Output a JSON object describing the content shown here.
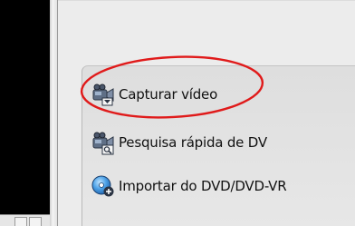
{
  "menu": {
    "items": [
      {
        "label": "Capturar vídeo",
        "icon": "video-camera-capture-icon"
      },
      {
        "label": "Pesquisa rápida de DV",
        "icon": "camcorder-search-icon"
      },
      {
        "label": "Importar do DVD/DVD-VR",
        "icon": "dvd-import-icon"
      }
    ]
  },
  "colors": {
    "annotation": "#e01a1a",
    "panel": "#e2e2e2",
    "player_background": "#000000"
  }
}
